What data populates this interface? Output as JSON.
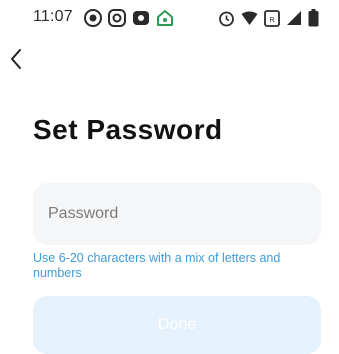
{
  "status_bar": {
    "time": "11:07",
    "left_icons": [
      "status-app-icon",
      "status-app-icon-2",
      "status-app-icon-3",
      "home-icon"
    ],
    "right_icons": [
      "alarm-icon",
      "wifi-icon",
      "sim-icon",
      "signal-icon",
      "battery-icon"
    ]
  },
  "nav": {
    "back_icon": "chevron-left-icon"
  },
  "page": {
    "title": "Set Password"
  },
  "password_field": {
    "placeholder": "Password",
    "value": ""
  },
  "hint": "Use 6-20 characters with a mix of letters and numbers",
  "done_button": {
    "label": "Done",
    "enabled": false
  },
  "colors": {
    "hint": "#3e9cd6",
    "button_disabled_bg": "#e6f2fb",
    "field_bg": "#f5f6f7"
  }
}
